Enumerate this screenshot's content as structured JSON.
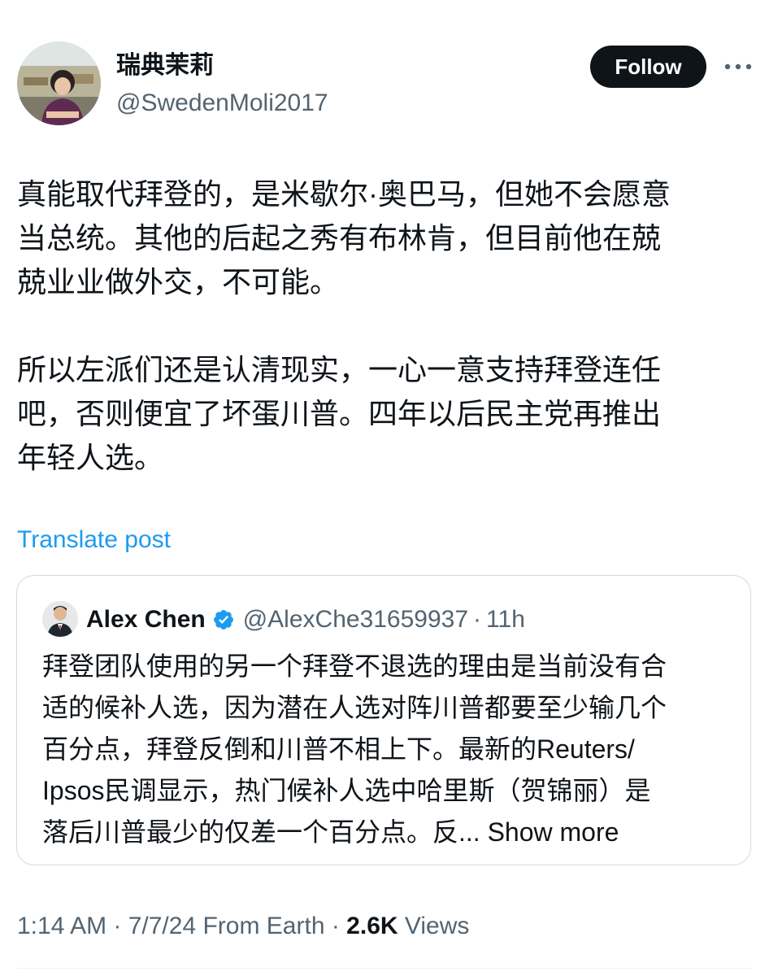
{
  "author": {
    "display_name": "瑞典茉莉",
    "handle": "@SwedenMoli2017",
    "avatar_icon": "profile-photo"
  },
  "actions": {
    "follow_label": "Follow",
    "more_icon": "ellipsis-icon"
  },
  "post": {
    "text": "真能取代拜登的，是米歇尔·奥巴马，但她不会愿意\n当总统。其他的后起之秀有布林肯，但目前他在兢\n兢业业做外交，不可能。\n\n所以左派们还是认清现实，一心一意支持拜登连任\n吧，否则便宜了坏蛋川普。四年以后民主党再推出\n年轻人选。",
    "translate_label": "Translate post"
  },
  "quoted_post": {
    "display_name": "Alex Chen",
    "handle": "@AlexChe31659937",
    "separator": "·",
    "time": "11h",
    "verified_icon": "verified-badge-icon",
    "text": "拜登团队使用的另一个拜登不退选的理由是当前没有合\n适的候补人选，因为潜在人选对阵川普都要至少输几个\n百分点，拜登反倒和川普不相上下。最新的Reuters/\nIpsos民调显示，热门候补人选中哈里斯（贺锦丽）是\n落后川普最少的仅差一个百分点。反...",
    "show_more_label": " Show more"
  },
  "meta": {
    "timestamp": "1:14 AM · 7/7/24 From Earth · ",
    "views_count": "2.6K",
    "views_label": " Views"
  },
  "colors": {
    "text_primary": "#0f1419",
    "text_secondary": "#536471",
    "link": "#1d9bf0",
    "verified": "#1d9bf0",
    "border": "#cfd9de",
    "button_bg": "#0f1419"
  }
}
